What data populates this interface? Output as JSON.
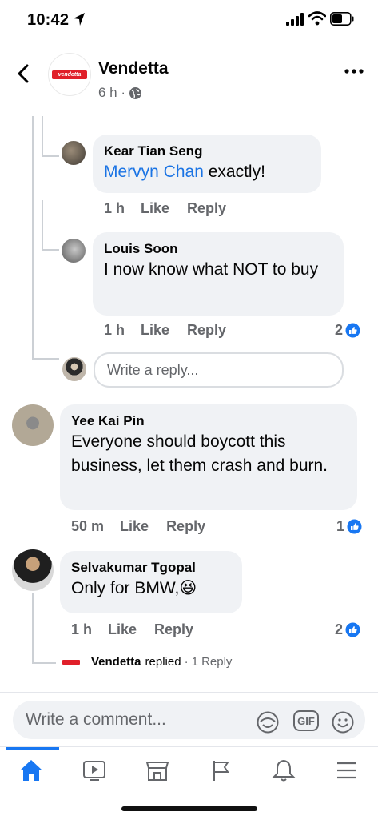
{
  "status_bar": {
    "time": "10:42"
  },
  "header": {
    "page_name": "Vendetta",
    "logo_text": "vendetta",
    "time_ago": "6 h ·"
  },
  "comments": [
    {
      "author": "Kear Tian Seng",
      "mention": "Mervyn Chan",
      "text": " exactly!",
      "time": "1 h",
      "like": "Like",
      "reply": "Reply",
      "reactions": ""
    },
    {
      "author": "Louis Soon",
      "text": "I now know what NOT to buy",
      "time": "1 h",
      "like": "Like",
      "reply": "Reply",
      "reactions": "2"
    },
    {
      "author": "Yee Kai Pin",
      "text": "Everyone should boycott this business, let them crash and burn.",
      "time": "50 m",
      "like": "Like",
      "reply": "Reply",
      "reactions": "1"
    },
    {
      "author": "Selvakumar Tgopal",
      "text": "Only for BMW,",
      "emoji": "😆",
      "time": "1 h",
      "like": "Like",
      "reply": "Reply",
      "reactions": "2"
    }
  ],
  "reply_input": {
    "placeholder": "Write a reply..."
  },
  "replied": {
    "who": "Vendetta",
    "verb": "replied",
    "count": "1 Reply"
  },
  "composer": {
    "placeholder": "Write a comment...",
    "gif_label": "GIF"
  },
  "tabs": [
    {
      "name": "home",
      "icon": "home-icon",
      "active": true
    },
    {
      "name": "watch",
      "icon": "video-icon",
      "active": false
    },
    {
      "name": "marketplace",
      "icon": "store-icon",
      "active": false
    },
    {
      "name": "pages",
      "icon": "flag-icon",
      "active": false
    },
    {
      "name": "notifications",
      "icon": "bell-icon",
      "active": false
    },
    {
      "name": "menu",
      "icon": "menu-icon",
      "active": false
    }
  ],
  "colors": {
    "accent": "#1877f2",
    "mention": "#1b74e4",
    "bubble": "#f0f2f5",
    "muted": "#65676b",
    "brand_red": "#e0202a"
  }
}
